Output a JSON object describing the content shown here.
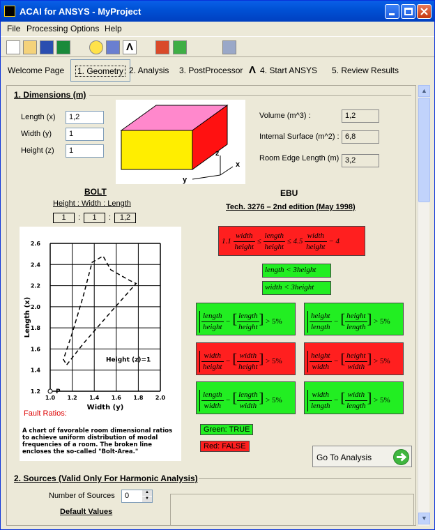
{
  "window": {
    "title": "ACAI for ANSYS - MyProject"
  },
  "menu": {
    "file": "File",
    "processing": "Processing",
    "options": "Options",
    "help": "Help"
  },
  "toolbar": {
    "icons": [
      "new-file-icon",
      "open-file-icon",
      "save-icon",
      "save-as-icon",
      "settings-icon",
      "book-icon",
      "ansys-icon",
      "house-red-icon",
      "house-green-icon",
      "calculator-icon"
    ]
  },
  "tabs": [
    {
      "label": "Welcome Page"
    },
    {
      "label": "1. Geometry"
    },
    {
      "label": "2. Analysis"
    },
    {
      "label": "3. PostProcessor"
    },
    {
      "label": "4. Start ANSYS"
    },
    {
      "label": "5. Review Results"
    }
  ],
  "dimensions": {
    "title": "1. Dimensions (m)",
    "length_label": "Length (x)",
    "length_value": "1,2",
    "width_label": "Width  (y)",
    "width_value": "1",
    "height_label": "Height (z)",
    "height_value": "1",
    "volume_label": "Volume (m^3) :",
    "volume_value": "1,2",
    "surface_label": "Internal Surface (m^2) :",
    "surface_value": "6,8",
    "edge_label": "Room Edge Length (m)",
    "edge_value": "3,2",
    "axis_z": "z",
    "axis_x": "x",
    "axis_y": "y"
  },
  "bolt": {
    "title": "BOLT",
    "ratio_header": "Height  :  Width  :  Length",
    "h": "1",
    "w": "1",
    "l": "1,2",
    "sep": ":",
    "chart_ylabel": "Length (x)",
    "chart_xlabel": "Width (y)",
    "yticks": [
      "2.6",
      "2.4",
      "2.2",
      "2.0",
      "1.8",
      "1.6",
      "1.4",
      "1.2"
    ],
    "xticks": [
      "1.0",
      "1.2",
      "1.4",
      "1.6",
      "1.8",
      "2.0"
    ],
    "height_note": "Height (z)=1",
    "point_label": "P",
    "fault": "Fault Ratios:",
    "caption": "A chart of favorable room dimensional ratios to achieve uniform distribution of modal frequencies of a room. The broken line encloses the so-called \"Bolt-Area.\""
  },
  "ebu": {
    "title": "EBU",
    "subtitle": "Tech. 3276 – 2nd edition (May 1998)",
    "c1": {
      "a": "1.1",
      "w": "width",
      "h": "height",
      "le": "≤",
      "l": "length",
      "b": "≤ 4.5",
      "c": "− 4"
    },
    "c2": {
      "text": "length < 3height"
    },
    "c3": {
      "text": "width < 3height"
    },
    "pct": "> 5%",
    "len": "length",
    "hei": "height",
    "wid": "width",
    "minus": "−"
  },
  "legend": {
    "green": "Green: TRUE",
    "red": "Red: FALSE"
  },
  "goto": {
    "label": "Go To Analysis"
  },
  "sources": {
    "title": "2. Sources (Valid Only For Harmonic Analysis)",
    "num_label": "Number of Sources",
    "num_value": "0",
    "defaults": "Default Values"
  },
  "colors": {
    "true": "#22ee22",
    "false": "#ff1f1f",
    "title_bar": "#0052d6"
  }
}
